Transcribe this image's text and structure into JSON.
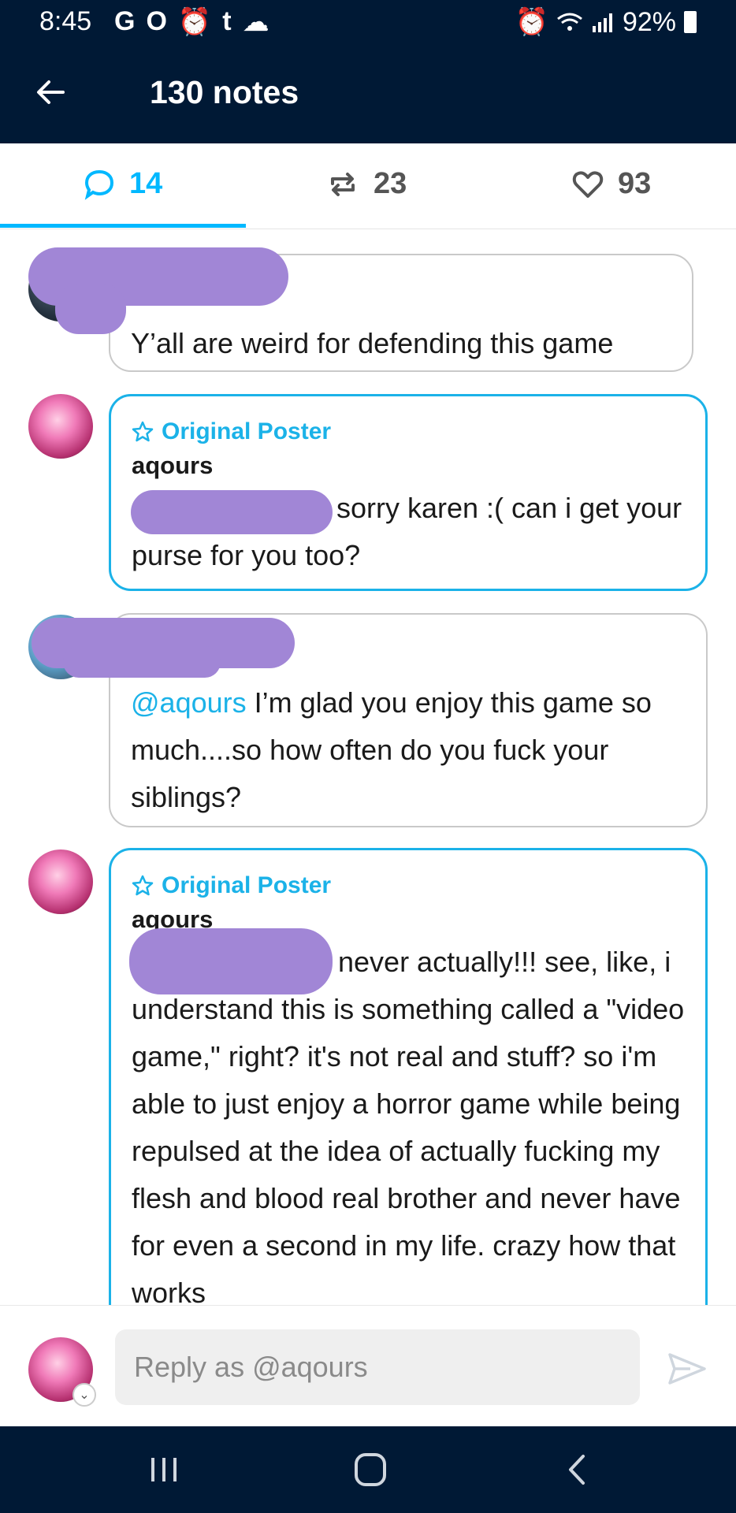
{
  "status_bar": {
    "time": "8:45",
    "left_icons": [
      "G",
      "O",
      "⏰",
      "t",
      "☁"
    ],
    "battery_text": "92%"
  },
  "header": {
    "title": "130 notes"
  },
  "tabs": [
    {
      "label": "14",
      "icon": "comment-icon",
      "active": true
    },
    {
      "label": "23",
      "icon": "reblog-icon",
      "active": false
    },
    {
      "label": "93",
      "icon": "heart-icon",
      "active": false
    }
  ],
  "replies": [
    {
      "author": "",
      "op": false,
      "text": "Y’all are weird for defending this game"
    },
    {
      "author": "aqours",
      "op": true,
      "op_label": "Original Poster",
      "text": "sorry karen :( can i get your purse for you too?"
    },
    {
      "author": "",
      "op": false,
      "mention": "@aqours",
      "text": " I’m glad you enjoy this game so much....so how often do you fuck your siblings?"
    },
    {
      "author": "aqours",
      "op": true,
      "op_label": "Original Poster",
      "text": "never actually!!! see, like, i understand this is something called a \"video game,\" right? it's not real and stuff? so i'm able to just enjoy a horror game while being repulsed at the idea of actually fucking my flesh and blood real brother and never have for even a second in my life. crazy how that works"
    }
  ],
  "reply_box": {
    "placeholder": "Reply as @aqours"
  },
  "colors": {
    "header_bg": "#001935",
    "accent": "#00b8ff",
    "op_border": "#1bb2e8",
    "redaction": "#a186d6"
  }
}
